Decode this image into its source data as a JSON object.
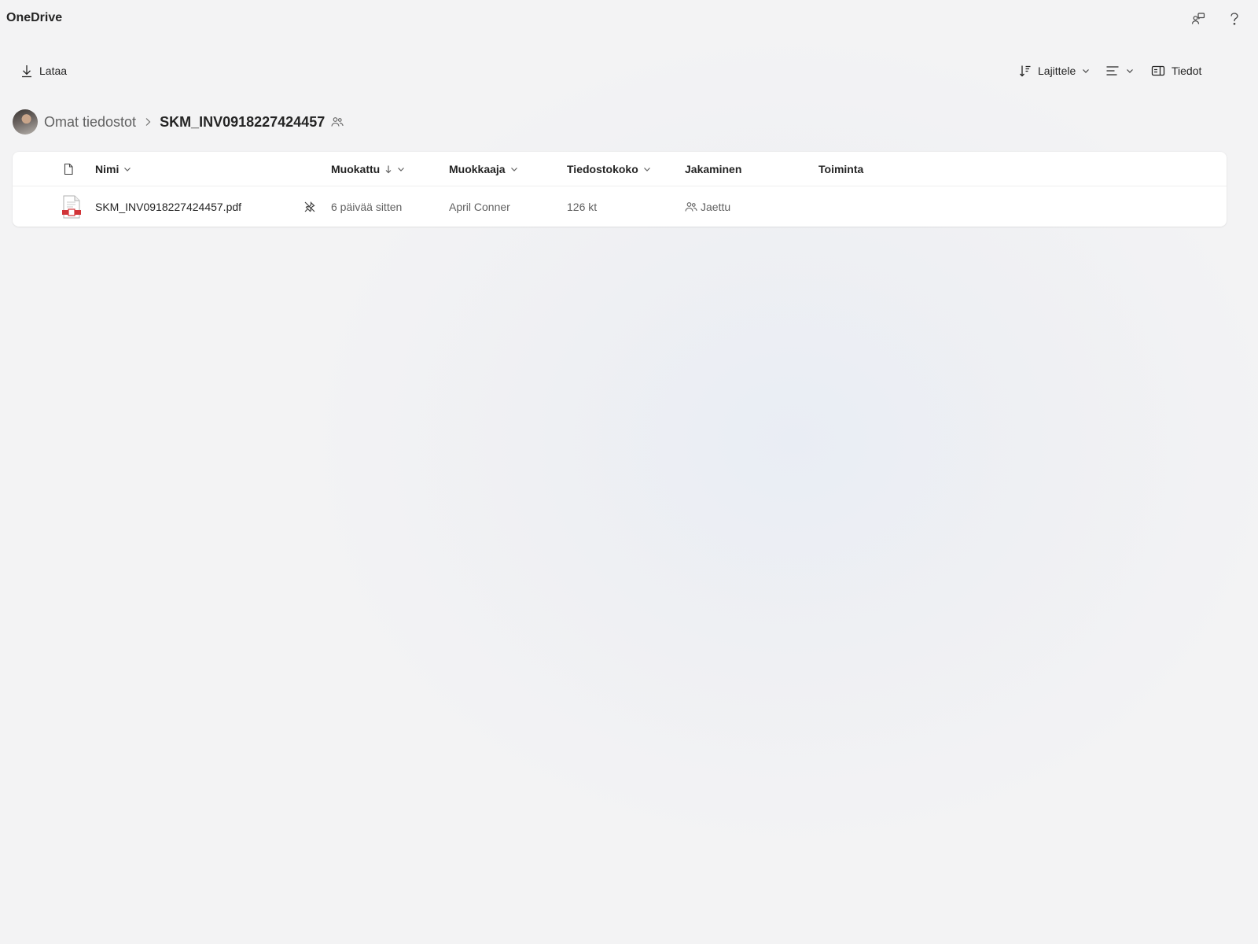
{
  "app": {
    "title": "OneDrive"
  },
  "topbar": {
    "icons": [
      {
        "name": "feedback-icon",
        "label": "Palaute"
      },
      {
        "name": "help-icon",
        "label": "?"
      }
    ]
  },
  "commands": {
    "download": "Lataa",
    "sort": "Lajittele",
    "details": "Tiedot"
  },
  "breadcrumb": {
    "root": "Omat tiedostot",
    "current": "SKM_INV0918227424457"
  },
  "table": {
    "columns": {
      "name": "Nimi",
      "modified": "Muokattu",
      "modified_by": "Muokkaaja",
      "size": "Tiedostokoko",
      "sharing": "Jakaminen",
      "activity": "Toiminta"
    },
    "rows": [
      {
        "name": "SKM_INV0918227424457.pdf",
        "modified": "6 päivää sitten",
        "modified_by": "April Conner",
        "size": "126 kt",
        "sharing": "Jaettu",
        "activity": ""
      }
    ]
  },
  "colors": {
    "pdf_accent": "#d13438",
    "background": "#f3f3f4",
    "text": "#242424",
    "muted_text": "#616161"
  }
}
